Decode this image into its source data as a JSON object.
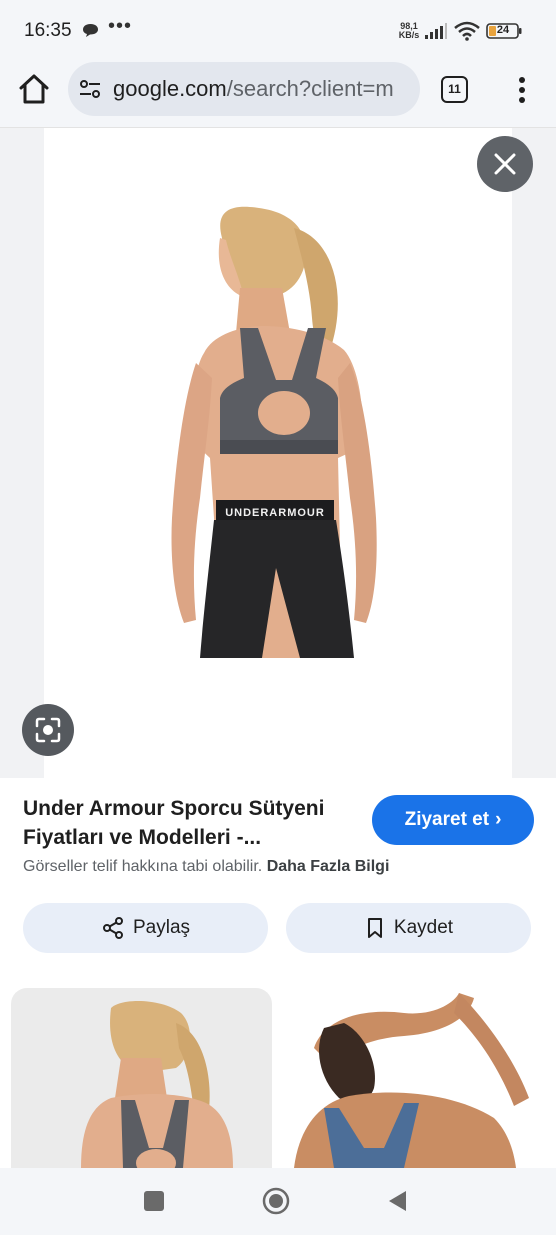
{
  "status_bar": {
    "time": "16:35",
    "more": "•••",
    "speed_value": "98,1",
    "speed_unit": "KB/s",
    "battery": "24",
    "icons": [
      "message-icon",
      "signal-icon",
      "wifi-icon",
      "battery-icon"
    ]
  },
  "browser": {
    "url_host": "google.com",
    "url_path": "/search?client=m",
    "tab_count": "11",
    "icons": [
      "home-icon",
      "site-settings-icon",
      "menu-icon"
    ]
  },
  "viewer": {
    "image_alt": "Under Armour sports bra back view",
    "icons": [
      "close-icon",
      "lens-icon"
    ]
  },
  "result": {
    "title": "Under Armour Sporcu Sütyeni Fiyatları ve Modelleri -...",
    "visit_label": "Ziyaret et",
    "visit_arrow": "›",
    "copyright_text": "Görseller telif hakkına tabi olabilir.",
    "learn_more": "Daha Fazla Bilgi",
    "share_label": "Paylaş",
    "save_label": "Kaydet"
  },
  "related": {
    "items": [
      "related-image-1",
      "related-image-2"
    ]
  },
  "colors": {
    "accent": "#1a73e8",
    "pill_bg": "#e8eef8",
    "chrome_bg": "#f4f6f9",
    "battery": "#e8a33d"
  }
}
